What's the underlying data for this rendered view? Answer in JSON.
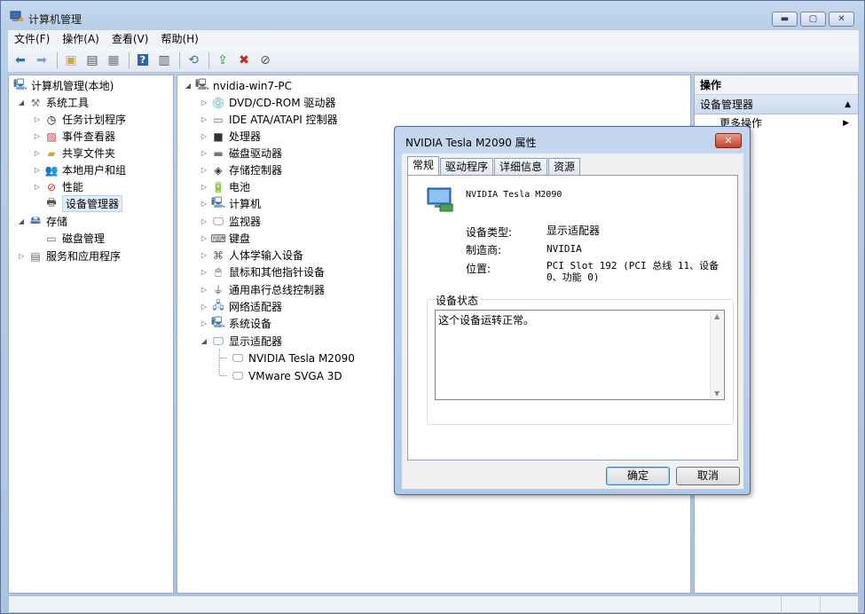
{
  "window": {
    "title": "计算机管理",
    "controls": [
      "minimize-icon",
      "maximize-icon",
      "close-icon"
    ]
  },
  "menu": [
    "文件(F)",
    "操作(A)",
    "查看(V)",
    "帮助(H)"
  ],
  "left_tree": [
    {
      "label": "计算机管理(本地)",
      "icon": "computer-mgmt-icon",
      "twisty": ""
    },
    {
      "label": "系统工具",
      "icon": "tools-icon",
      "twisty": "◢"
    },
    {
      "label": "任务计划程序",
      "icon": "clock-icon",
      "twisty": "▷"
    },
    {
      "label": "事件查看器",
      "icon": "event-viewer-icon",
      "twisty": "▷"
    },
    {
      "label": "共享文件夹",
      "icon": "shared-folder-icon",
      "twisty": "▷"
    },
    {
      "label": "本地用户和组",
      "icon": "users-icon",
      "twisty": "▷"
    },
    {
      "label": "性能",
      "icon": "performance-icon",
      "twisty": "▷"
    },
    {
      "label": "设备管理器",
      "icon": "device-manager-icon",
      "twisty": ""
    },
    {
      "label": "存储",
      "icon": "storage-icon",
      "twisty": "◢"
    },
    {
      "label": "磁盘管理",
      "icon": "disk-icon",
      "twisty": ""
    },
    {
      "label": "服务和应用程序",
      "icon": "services-icon",
      "twisty": "▷"
    }
  ],
  "device_tree": {
    "root": "nvidia-win7-PC",
    "categories": [
      "DVD/CD-ROM 驱动器",
      "IDE ATA/ATAPI 控制器",
      "处理器",
      "磁盘驱动器",
      "存储控制器",
      "电池",
      "计算机",
      "监视器",
      "键盘",
      "人体学输入设备",
      "鼠标和其他指针设备",
      "通用串行总线控制器",
      "网络适配器",
      "系统设备",
      "显示适配器"
    ],
    "display_children": [
      "NVIDIA Tesla M2090",
      "VMware SVGA 3D"
    ]
  },
  "actions_pane": {
    "header": "操作",
    "section": "设备管理器",
    "more": "更多操作"
  },
  "dialog": {
    "title": "NVIDIA Tesla M2090 属性",
    "tabs": [
      "常规",
      "驱动程序",
      "详细信息",
      "资源"
    ],
    "device_name": "NVIDIA Tesla M2090",
    "props": [
      {
        "label": "设备类型:",
        "value": "显示适配器"
      },
      {
        "label": "制造商:",
        "value": "NVIDIA"
      },
      {
        "label": "位置:",
        "value": "PCI Slot 192 (PCI 总线 11、设备 0、功能 0)"
      }
    ],
    "status_group_label": "设备状态",
    "status_text": "这个设备运转正常。",
    "ok_label": "确定",
    "cancel_label": "取消"
  }
}
